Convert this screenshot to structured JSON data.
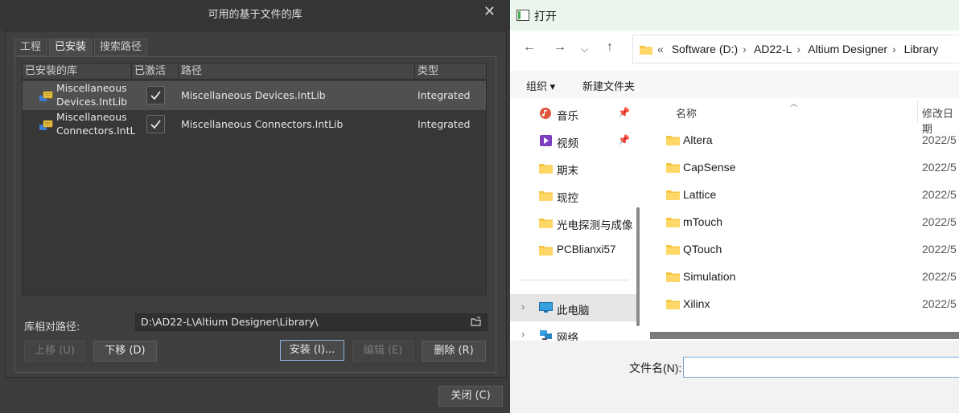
{
  "altium_dialog": {
    "title": "可用的基于文件的库",
    "close_glyph": "✕",
    "tabs": [
      "工程",
      "已安装",
      "搜索路径"
    ],
    "active_tab": "已安装",
    "columns": [
      "已安装的库",
      "已激活",
      "路径",
      "类型"
    ],
    "rows": [
      {
        "library": "Miscellaneous Devices.IntLib",
        "library_lines": [
          "Miscellaneous",
          "Devices.IntLib"
        ],
        "active": true,
        "path": "Miscellaneous Devices.IntLib",
        "type": "Integrated"
      },
      {
        "library": "Miscellaneous Connectors.IntLib",
        "library_lines": [
          "Miscellaneous",
          "Connectors.IntLil"
        ],
        "active": true,
        "path": "Miscellaneous Connectors.IntLib",
        "type": "Integrated"
      }
    ],
    "relative_path_label": "库相对路径:",
    "relative_path_value": "D:\\AD22-L\\Altium Designer\\Library\\",
    "buttons": {
      "move_up": "上移 (U)",
      "move_down": "下移 (D)",
      "install": "安装 (I)...",
      "edit": "编辑 (E)",
      "remove": "删除 (R)",
      "close": "关闭 (C)"
    }
  },
  "open_dialog": {
    "title": "打开",
    "address": [
      "Software (D:)",
      "AD22-L",
      "Altium Designer",
      "Library"
    ],
    "address_prefix": "«",
    "toolbar": {
      "organize": "组织 ▾",
      "new_folder": "新建文件夹"
    },
    "sidebar": [
      {
        "label": "音乐",
        "icon": "music-icon",
        "pinned": true
      },
      {
        "label": "视频",
        "icon": "video-icon",
        "pinned": true
      },
      {
        "label": "期末",
        "icon": "folder-icon",
        "pinned": false
      },
      {
        "label": "现控",
        "icon": "folder-icon",
        "pinned": false
      },
      {
        "label": "光电探测与成像",
        "icon": "folder-icon",
        "pinned": false
      },
      {
        "label": "PCBlianxi57",
        "icon": "folder-icon",
        "pinned": false
      },
      {
        "label": "此电脑",
        "icon": "pc-icon",
        "pinned": false
      },
      {
        "label": "网络",
        "icon": "network-icon",
        "pinned": false
      }
    ],
    "list_headers": {
      "name": "名称",
      "date": "修改日期"
    },
    "files": [
      {
        "name": "Altera",
        "date": "2022/5"
      },
      {
        "name": "CapSense",
        "date": "2022/5"
      },
      {
        "name": "Lattice",
        "date": "2022/5"
      },
      {
        "name": "mTouch",
        "date": "2022/5"
      },
      {
        "name": "QTouch",
        "date": "2022/5"
      },
      {
        "name": "Simulation",
        "date": "2022/5"
      },
      {
        "name": "Xilinx",
        "date": "2022/5"
      }
    ],
    "filename_label": "文件名(N):",
    "filename_value": ""
  }
}
